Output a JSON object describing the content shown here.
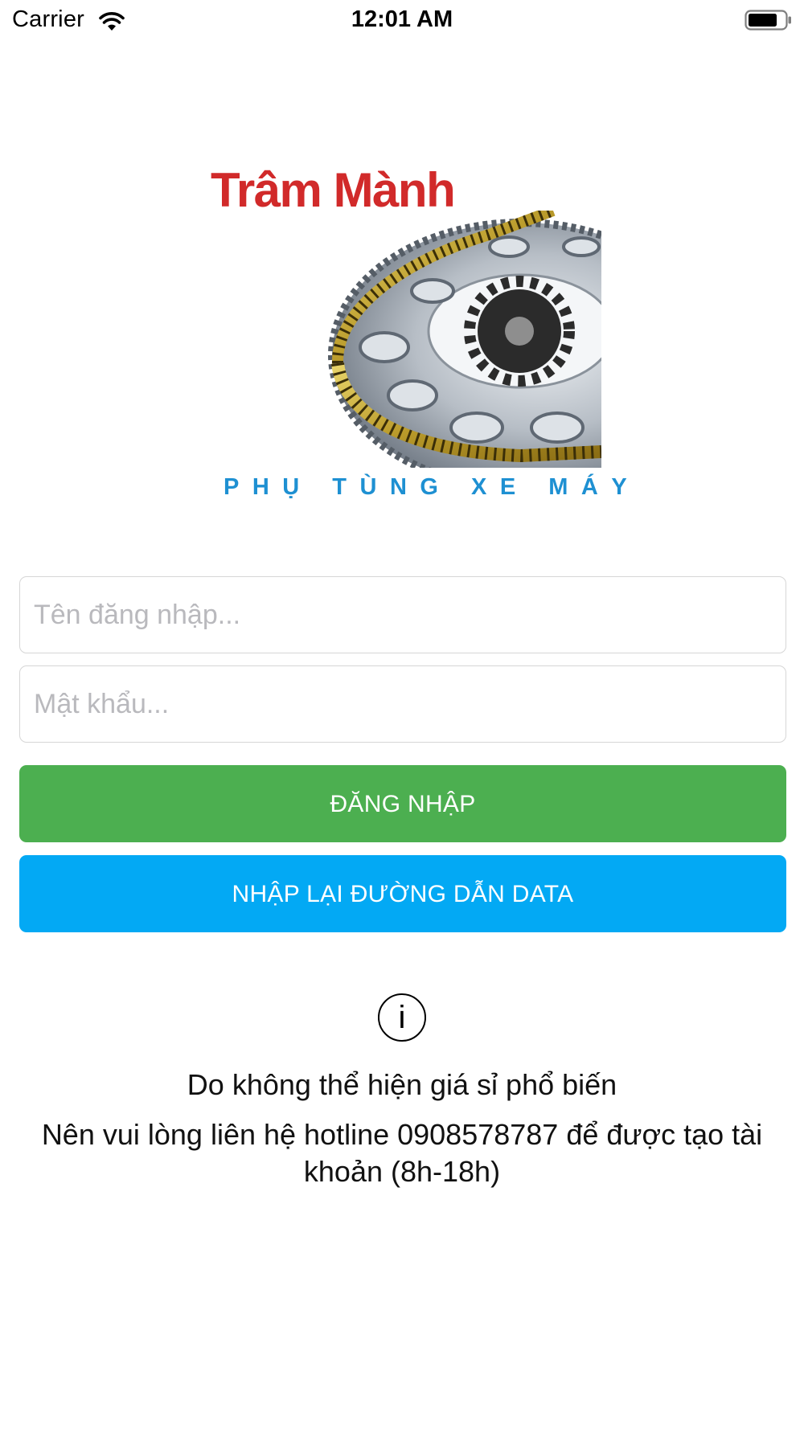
{
  "status_bar": {
    "carrier": "Carrier",
    "time": "12:01 AM",
    "icons": [
      "wifi-icon",
      "battery-icon"
    ]
  },
  "logo": {
    "brand_name": "Trâm Mành",
    "tagline": "PHỤ TÙNG XE MÁY",
    "brand_color": "#d12a2a",
    "tagline_color": "#1e90d2"
  },
  "login_form": {
    "username_placeholder": "Tên đăng nhập...",
    "username_value": "",
    "password_placeholder": "Mật khẩu...",
    "password_value": ""
  },
  "buttons": {
    "login_label": "ĐĂNG NHẬP",
    "login_color": "#4caf50",
    "reset_data_label": "NHẬP LẠI ĐƯỜNG DẪN DATA",
    "reset_data_color": "#03a9f4"
  },
  "info": {
    "icon": "info-icon",
    "icon_glyph": "i",
    "line1": "Do không thể hiện giá sỉ phổ biến",
    "line2": "Nên vui lòng liên hệ hotline 0908578787 để được tạo tài khoản (8h-18h)"
  }
}
